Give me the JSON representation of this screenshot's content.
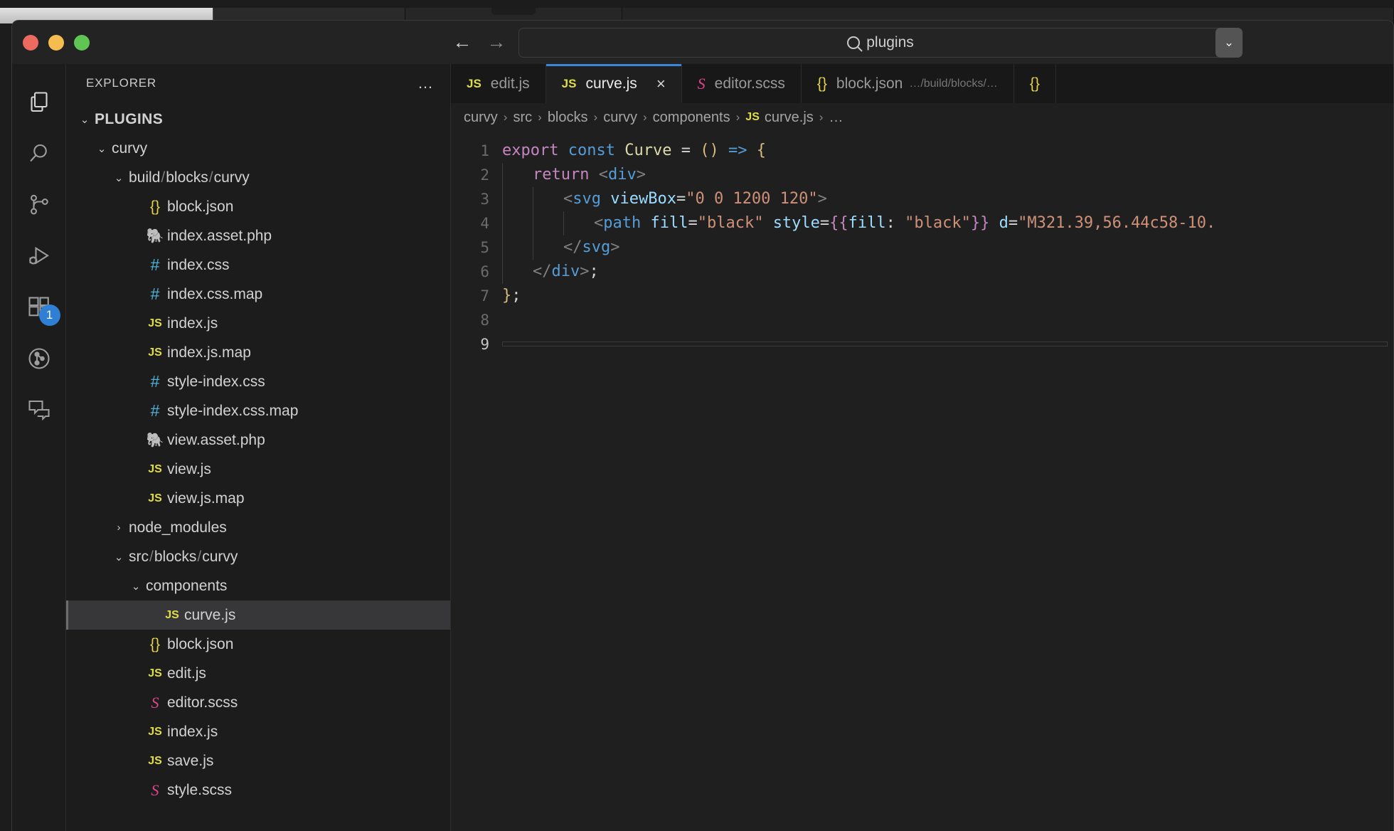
{
  "window": {
    "traffic_lights": [
      "close",
      "minimize",
      "maximize"
    ],
    "back_arrow": "←",
    "forward_arrow": "→",
    "search_value": "plugins",
    "search_dropdown_glyph": "⌄"
  },
  "activity_bar": {
    "items": [
      {
        "name": "explorer",
        "badge": ""
      },
      {
        "name": "search",
        "badge": ""
      },
      {
        "name": "source-control",
        "badge": ""
      },
      {
        "name": "run-and-debug",
        "badge": ""
      },
      {
        "name": "extensions",
        "badge": "1"
      },
      {
        "name": "git-graph",
        "badge": ""
      },
      {
        "name": "comments",
        "badge": ""
      }
    ]
  },
  "sidebar": {
    "title": "EXPLORER",
    "more_actions": "…",
    "tree": [
      {
        "label": "PLUGINS",
        "indent": 0,
        "chevron": "⌄",
        "icon": "",
        "bold": true,
        "selected": false
      },
      {
        "label": "curvy",
        "indent": 1,
        "chevron": "⌄",
        "icon": "",
        "bold": false,
        "selected": false
      },
      {
        "label": "build/blocks/curvy",
        "indent": 2,
        "chevron": "⌄",
        "icon": "",
        "bold": false,
        "selected": false,
        "path": true
      },
      {
        "label": "block.json",
        "indent": 3,
        "chevron": "",
        "icon": "json",
        "icon_glyph": "{}",
        "bold": false,
        "selected": false
      },
      {
        "label": "index.asset.php",
        "indent": 3,
        "chevron": "",
        "icon": "php",
        "icon_glyph": "🐘",
        "bold": false,
        "selected": false
      },
      {
        "label": "index.css",
        "indent": 3,
        "chevron": "",
        "icon": "css",
        "icon_glyph": "#",
        "bold": false,
        "selected": false
      },
      {
        "label": "index.css.map",
        "indent": 3,
        "chevron": "",
        "icon": "css",
        "icon_glyph": "#",
        "bold": false,
        "selected": false
      },
      {
        "label": "index.js",
        "indent": 3,
        "chevron": "",
        "icon": "js",
        "icon_glyph": "JS",
        "bold": false,
        "selected": false
      },
      {
        "label": "index.js.map",
        "indent": 3,
        "chevron": "",
        "icon": "js",
        "icon_glyph": "JS",
        "bold": false,
        "selected": false
      },
      {
        "label": "style-index.css",
        "indent": 3,
        "chevron": "",
        "icon": "css",
        "icon_glyph": "#",
        "bold": false,
        "selected": false
      },
      {
        "label": "style-index.css.map",
        "indent": 3,
        "chevron": "",
        "icon": "css",
        "icon_glyph": "#",
        "bold": false,
        "selected": false
      },
      {
        "label": "view.asset.php",
        "indent": 3,
        "chevron": "",
        "icon": "php",
        "icon_glyph": "🐘",
        "bold": false,
        "selected": false
      },
      {
        "label": "view.js",
        "indent": 3,
        "chevron": "",
        "icon": "js",
        "icon_glyph": "JS",
        "bold": false,
        "selected": false
      },
      {
        "label": "view.js.map",
        "indent": 3,
        "chevron": "",
        "icon": "js",
        "icon_glyph": "JS",
        "bold": false,
        "selected": false
      },
      {
        "label": "node_modules",
        "indent": 2,
        "chevron": "›",
        "icon": "",
        "bold": false,
        "selected": false
      },
      {
        "label": "src/blocks/curvy",
        "indent": 2,
        "chevron": "⌄",
        "icon": "",
        "bold": false,
        "selected": false,
        "path": true
      },
      {
        "label": "components",
        "indent": 3,
        "chevron": "⌄",
        "icon": "",
        "bold": false,
        "selected": false
      },
      {
        "label": "curve.js",
        "indent": 4,
        "chevron": "",
        "icon": "js",
        "icon_glyph": "JS",
        "bold": false,
        "selected": true
      },
      {
        "label": "block.json",
        "indent": 3,
        "chevron": "",
        "icon": "json",
        "icon_glyph": "{}",
        "bold": false,
        "selected": false
      },
      {
        "label": "edit.js",
        "indent": 3,
        "chevron": "",
        "icon": "js",
        "icon_glyph": "JS",
        "bold": false,
        "selected": false
      },
      {
        "label": "editor.scss",
        "indent": 3,
        "chevron": "",
        "icon": "scss",
        "icon_glyph": "S",
        "bold": false,
        "selected": false
      },
      {
        "label": "index.js",
        "indent": 3,
        "chevron": "",
        "icon": "js",
        "icon_glyph": "JS",
        "bold": false,
        "selected": false
      },
      {
        "label": "save.js",
        "indent": 3,
        "chevron": "",
        "icon": "js",
        "icon_glyph": "JS",
        "bold": false,
        "selected": false
      },
      {
        "label": "style.scss",
        "indent": 3,
        "chevron": "",
        "icon": "scss",
        "icon_glyph": "S",
        "bold": false,
        "selected": false
      }
    ]
  },
  "editor": {
    "tabs": [
      {
        "label": "edit.js",
        "icon": "js",
        "icon_glyph": "JS",
        "path": "",
        "active": false,
        "closable": false
      },
      {
        "label": "curve.js",
        "icon": "js",
        "icon_glyph": "JS",
        "path": "",
        "active": true,
        "closable": true,
        "close_glyph": "×"
      },
      {
        "label": "editor.scss",
        "icon": "scss",
        "icon_glyph": "S",
        "path": "",
        "active": false,
        "closable": false
      },
      {
        "label": "block.json",
        "icon": "json",
        "icon_glyph": "{}",
        "path": "…/build/blocks/…",
        "active": false,
        "closable": false
      },
      {
        "label": "",
        "icon": "json",
        "icon_glyph": "{}",
        "path": "",
        "active": false,
        "closable": false
      }
    ],
    "breadcrumb": [
      {
        "label": "curvy",
        "icon": ""
      },
      {
        "label": "src",
        "icon": ""
      },
      {
        "label": "blocks",
        "icon": ""
      },
      {
        "label": "curvy",
        "icon": ""
      },
      {
        "label": "components",
        "icon": ""
      },
      {
        "label": "curve.js",
        "icon": "JS"
      },
      {
        "label": "…",
        "icon": ""
      }
    ],
    "breadcrumb_separator": "›",
    "code_lines": [
      {
        "num": "1",
        "current": false,
        "indent": 0,
        "tokens": [
          {
            "t": "export",
            "c": "k-export"
          },
          {
            "t": " ",
            "c": "k-white"
          },
          {
            "t": "const",
            "c": "k-const"
          },
          {
            "t": " ",
            "c": "k-white"
          },
          {
            "t": "Curve",
            "c": "k-name"
          },
          {
            "t": " ",
            "c": "k-white"
          },
          {
            "t": "=",
            "c": "k-op"
          },
          {
            "t": " ",
            "c": "k-white"
          },
          {
            "t": "()",
            "c": "k-paren"
          },
          {
            "t": " ",
            "c": "k-white"
          },
          {
            "t": "=>",
            "c": "k-arrow"
          },
          {
            "t": " ",
            "c": "k-white"
          },
          {
            "t": "{",
            "c": "k-brace"
          }
        ]
      },
      {
        "num": "2",
        "current": false,
        "indent": 1,
        "tokens": [
          {
            "t": "return",
            "c": "k-return"
          },
          {
            "t": " ",
            "c": "k-white"
          },
          {
            "t": "<",
            "c": "k-punct"
          },
          {
            "t": "div",
            "c": "k-tag"
          },
          {
            "t": ">",
            "c": "k-punct"
          }
        ]
      },
      {
        "num": "3",
        "current": false,
        "indent": 2,
        "tokens": [
          {
            "t": "<",
            "c": "k-punct"
          },
          {
            "t": "svg",
            "c": "k-tag"
          },
          {
            "t": " ",
            "c": "k-white"
          },
          {
            "t": "viewBox",
            "c": "k-attr"
          },
          {
            "t": "=",
            "c": "k-white"
          },
          {
            "t": "\"0 0 1200 120\"",
            "c": "k-str"
          },
          {
            "t": ">",
            "c": "k-punct"
          }
        ]
      },
      {
        "num": "4",
        "current": false,
        "indent": 3,
        "tokens": [
          {
            "t": "<",
            "c": "k-punct"
          },
          {
            "t": "path",
            "c": "k-tag"
          },
          {
            "t": " ",
            "c": "k-white"
          },
          {
            "t": "fill",
            "c": "k-attr"
          },
          {
            "t": "=",
            "c": "k-white"
          },
          {
            "t": "\"black\"",
            "c": "k-str"
          },
          {
            "t": " ",
            "c": "k-white"
          },
          {
            "t": "style",
            "c": "k-attr"
          },
          {
            "t": "=",
            "c": "k-white"
          },
          {
            "t": "{{",
            "c": "k-pink"
          },
          {
            "t": "fill",
            "c": "k-attr"
          },
          {
            "t": ": ",
            "c": "k-white"
          },
          {
            "t": "\"black\"",
            "c": "k-str"
          },
          {
            "t": "}}",
            "c": "k-pink"
          },
          {
            "t": " ",
            "c": "k-white"
          },
          {
            "t": "d",
            "c": "k-attr"
          },
          {
            "t": "=",
            "c": "k-white"
          },
          {
            "t": "\"M321.39,56.44c58-10.",
            "c": "k-str"
          }
        ]
      },
      {
        "num": "5",
        "current": false,
        "indent": 2,
        "tokens": [
          {
            "t": "</",
            "c": "k-punct"
          },
          {
            "t": "svg",
            "c": "k-tag"
          },
          {
            "t": ">",
            "c": "k-punct"
          }
        ]
      },
      {
        "num": "6",
        "current": false,
        "indent": 1,
        "tokens": [
          {
            "t": "</",
            "c": "k-punct"
          },
          {
            "t": "div",
            "c": "k-tag"
          },
          {
            "t": ">",
            "c": "k-punct"
          },
          {
            "t": ";",
            "c": "k-white"
          }
        ]
      },
      {
        "num": "7",
        "current": false,
        "indent": 0,
        "tokens": [
          {
            "t": "}",
            "c": "k-brace"
          },
          {
            "t": ";",
            "c": "k-white"
          }
        ]
      },
      {
        "num": "8",
        "current": false,
        "indent": 0,
        "tokens": []
      },
      {
        "num": "9",
        "current": true,
        "indent": 0,
        "tokens": []
      }
    ]
  }
}
